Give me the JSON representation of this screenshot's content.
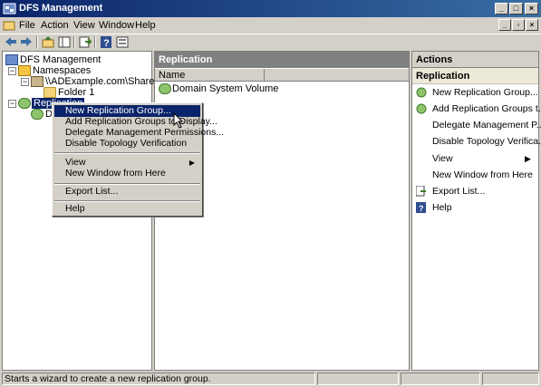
{
  "window": {
    "title": "DFS Management",
    "controls": [
      "_",
      "□",
      "×"
    ]
  },
  "menubar": {
    "items": [
      "File",
      "Action",
      "View",
      "Window",
      "Help"
    ]
  },
  "toolbar": {
    "icons": [
      "back-icon",
      "forward-icon",
      "up-icon",
      "show-hide-tree-icon",
      "export-icon",
      "help-icon",
      "properties-icon"
    ]
  },
  "tree": {
    "root": "DFS Management",
    "namespaces": "Namespaces",
    "namespace_path": "\\\\ADExample.com\\Sharedfiles",
    "folder": "Folder 1",
    "replication": "Replication",
    "replication_child": "Do"
  },
  "center": {
    "header": "Replication",
    "column": "Name",
    "rows": [
      "Domain System Volume"
    ]
  },
  "actions": {
    "header": "Actions",
    "section": "Replication",
    "items": [
      "New Replication Group...",
      "Add Replication Groups t...",
      "Delegate Management P...",
      "Disable Topology Verifica...",
      "View",
      "New Window from Here",
      "Export List...",
      "Help"
    ]
  },
  "context_menu": {
    "items": [
      "New Replication Group...",
      "Add Replication Groups to Display...",
      "Delegate Management Permissions...",
      "Disable Topology Verification",
      "View",
      "New Window from Here",
      "Export List...",
      "Help"
    ],
    "highlighted": "New Replication Group..."
  },
  "statusbar": {
    "text": "Starts a wizard to create a new replication group."
  },
  "colors": {
    "titlebar_start": "#0a246a",
    "titlebar_end": "#3a6ea5",
    "selection": "#0a246a",
    "chrome": "#d4d0c8"
  }
}
